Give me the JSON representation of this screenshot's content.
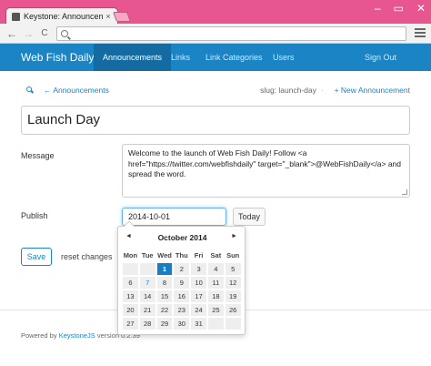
{
  "browser": {
    "tab_title": "Keystone: Announcement",
    "tab_close": "×",
    "minimize": "–",
    "restore": "▭",
    "close": "✕",
    "back": "←",
    "forward": "→",
    "reload": "C"
  },
  "nav": {
    "brand": "Web Fish Daily",
    "items": [
      "Announcements",
      "Links",
      "Link Categories",
      "Users"
    ],
    "signout": "Sign Out"
  },
  "subbar": {
    "back_label": "← Announcements",
    "slug": "slug: launch-day",
    "dot": "·",
    "new_label": "+ New Announcement"
  },
  "form": {
    "title_value": "Launch Day",
    "message_label": "Message",
    "message_value": "Welcome to the launch of Web Fish Daily! Follow <a href=\"https://twitter.com/webfishdaily\" target=\"_blank\">@WebFishDaily</a> and spread the word.",
    "publish_label": "Publish",
    "publish_value": "2014-10-01",
    "today_label": "Today",
    "save_label": "Save",
    "reset_label": "reset changes"
  },
  "datepicker": {
    "prev": "◄",
    "next": "►",
    "month": "October  2014",
    "dows": [
      "Mon",
      "Tue",
      "Wed",
      "Thu",
      "Fri",
      "Sat",
      "Sun"
    ],
    "days": [
      "",
      "",
      "1",
      "2",
      "3",
      "4",
      "5",
      "6",
      "7",
      "8",
      "9",
      "10",
      "11",
      "12",
      "13",
      "14",
      "15",
      "16",
      "17",
      "18",
      "19",
      "20",
      "21",
      "22",
      "23",
      "24",
      "25",
      "26",
      "27",
      "28",
      "29",
      "30",
      "31",
      "",
      ""
    ],
    "selected_day": "1",
    "today_day": "7"
  },
  "footer": {
    "prefix": "Powered by ",
    "link": "KeystoneJS",
    "suffix": " version 0.2.39"
  },
  "colors": {
    "accent": "#1a84c5",
    "frame": "#e8568f"
  }
}
